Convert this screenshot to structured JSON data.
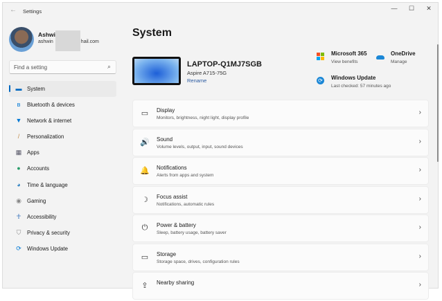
{
  "window": {
    "title": "Settings",
    "minimize": "—",
    "maximize": "☐",
    "close": "✕",
    "back": "←"
  },
  "user": {
    "name": "Ashwin",
    "email_start": "ashwin",
    "email_end": "hail.com"
  },
  "search": {
    "placeholder": "Find a setting",
    "icon": "⌕"
  },
  "nav": [
    {
      "label": "System",
      "icon": "▬",
      "color": "#0067c0"
    },
    {
      "label": "Bluetooth & devices",
      "icon": "ʙ",
      "color": "#0078d4"
    },
    {
      "label": "Network & internet",
      "icon": "▼",
      "color": "#0078d4"
    },
    {
      "label": "Personalization",
      "icon": "/",
      "color": "#c08a4a"
    },
    {
      "label": "Apps",
      "icon": "▦",
      "color": "#556"
    },
    {
      "label": "Accounts",
      "icon": "●",
      "color": "#2a9d6a"
    },
    {
      "label": "Time & language",
      "icon": "◕",
      "color": "#2a7fc0"
    },
    {
      "label": "Gaming",
      "icon": "◉",
      "color": "#888"
    },
    {
      "label": "Accessibility",
      "icon": "☥",
      "color": "#1a5fb4"
    },
    {
      "label": "Privacy & security",
      "icon": "⛉",
      "color": "#888"
    },
    {
      "label": "Windows Update",
      "icon": "⟳",
      "color": "#0078d4"
    }
  ],
  "page_title": "System",
  "device": {
    "name": "LAPTOP-Q1MJ7SGB",
    "model": "Aspire A715-75G",
    "rename": "Rename"
  },
  "quick": {
    "m365": {
      "title": "Microsoft 365",
      "sub": "View benefits"
    },
    "onedrive": {
      "title": "OneDrive",
      "sub": "Manage"
    },
    "update": {
      "title": "Windows Update",
      "sub": "Last checked: 57 minutes ago"
    }
  },
  "cards": [
    {
      "title": "Display",
      "sub": "Monitors, brightness, night light, display profile",
      "icon": "▭"
    },
    {
      "title": "Sound",
      "sub": "Volume levels, output, input, sound devices",
      "icon": "🔊"
    },
    {
      "title": "Notifications",
      "sub": "Alerts from apps and system",
      "icon": "🔔"
    },
    {
      "title": "Focus assist",
      "sub": "Notifications, automatic rules",
      "icon": "☽"
    },
    {
      "title": "Power & battery",
      "sub": "Sleep, battery usage, battery saver",
      "icon": "⏻"
    },
    {
      "title": "Storage",
      "sub": "Storage space, drives, configuration rules",
      "icon": "▭"
    },
    {
      "title": "Nearby sharing",
      "sub": "",
      "icon": "⇪"
    }
  ],
  "chevron": "›"
}
